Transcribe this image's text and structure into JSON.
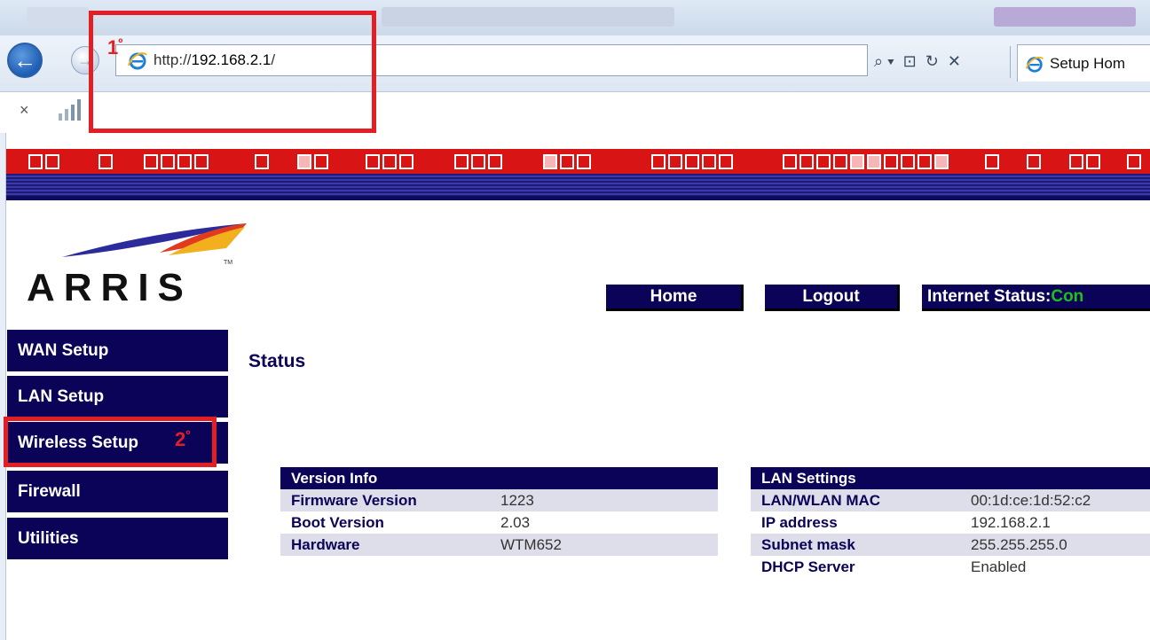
{
  "browser": {
    "url_prefix": "http://",
    "url_host": "192.168.2.1",
    "url_suffix": "/",
    "tab_title": "Setup Hom",
    "stop_symbol": "×",
    "addr_tools": [
      "⌕ ▾",
      "⊡",
      "↻",
      "✕"
    ]
  },
  "logo": {
    "text": "ARRIS"
  },
  "header_buttons": {
    "home": "Home",
    "logout": "Logout",
    "internet_status_label": "Internet Status: ",
    "internet_status_value": "Con"
  },
  "sidebar": {
    "items": [
      {
        "label": "WAN Setup"
      },
      {
        "label": "LAN Setup"
      },
      {
        "label": "Wireless Setup"
      },
      {
        "label": "Firewall"
      },
      {
        "label": "Utilities"
      }
    ]
  },
  "page_title": "Status",
  "version_info": {
    "title": "Version Info",
    "rows": [
      {
        "key": "Firmware Version",
        "value": "1223"
      },
      {
        "key": "Boot Version",
        "value": "2.03"
      },
      {
        "key": "Hardware",
        "value": "WTM652"
      }
    ]
  },
  "lan_settings": {
    "title": "LAN Settings",
    "rows": [
      {
        "key": "LAN/WLAN MAC",
        "value": "00:1d:ce:1d:52:c2"
      },
      {
        "key": "IP address",
        "value": "192.168.2.1"
      },
      {
        "key": "Subnet mask",
        "value": "255.255.255.0"
      },
      {
        "key": "DHCP Server",
        "value": "Enabled"
      }
    ]
  },
  "annotations": {
    "step1": "1",
    "step2": "2",
    "ordinal": "º"
  },
  "colors": {
    "navy": "#0b0357",
    "red_bar": "#d81414",
    "status_green": "#19c21e",
    "annotation_red": "#e31e24"
  }
}
